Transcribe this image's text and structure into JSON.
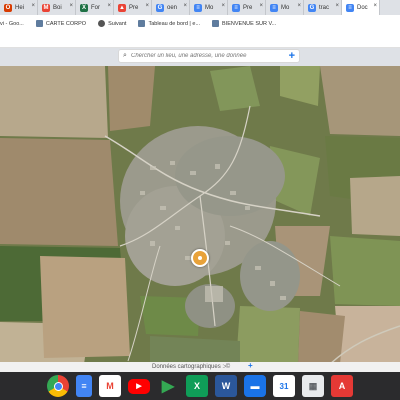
{
  "tabs": [
    {
      "label": "Hei",
      "icon": "office-icon",
      "color": "#d83b01",
      "glyph": "O"
    },
    {
      "label": "Boi",
      "icon": "gmail-icon",
      "color": "#ea4335",
      "glyph": "M"
    },
    {
      "label": "For",
      "icon": "excel-icon",
      "color": "#1e7145",
      "glyph": "X"
    },
    {
      "label": "Pre",
      "icon": "photos-icon",
      "color": "#ea4335",
      "glyph": "▲"
    },
    {
      "label": "oen",
      "icon": "google-icon",
      "color": "#4285f4",
      "glyph": "G"
    },
    {
      "label": "Mo",
      "icon": "doc-icon",
      "color": "#4285f4",
      "glyph": "≡"
    },
    {
      "label": "Pre",
      "icon": "doc-icon",
      "color": "#4285f4",
      "glyph": "≡"
    },
    {
      "label": "Mo",
      "icon": "doc-icon",
      "color": "#4285f4",
      "glyph": "≡"
    },
    {
      "label": "trac",
      "icon": "google-icon",
      "color": "#4285f4",
      "glyph": "G"
    },
    {
      "label": "Doc",
      "icon": "doc-icon",
      "color": "#4285f4",
      "glyph": "≡"
    }
  ],
  "tab_close": "×",
  "bookmarks": [
    {
      "label": "vi - Goo...",
      "icon": "none"
    },
    {
      "label": "CARTE CORPO",
      "icon": "map-icon"
    },
    {
      "label": "Suivant",
      "icon": "globe-icon"
    },
    {
      "label": "Tableau de bord | e...",
      "icon": "map-icon"
    },
    {
      "label": "BIENVENUE SUR V...",
      "icon": "map-icon"
    }
  ],
  "search": {
    "placeholder": "Chercher un lieu, une adresse, une donnée",
    "plus": "+"
  },
  "map_footer": {
    "label": "Données cartographiques : ©",
    "arrow": "›",
    "plus": "+"
  },
  "shelf": [
    {
      "name": "chrome-icon",
      "color": "#4285f4",
      "glyph": "◉"
    },
    {
      "name": "docs-icon",
      "color": "#4285f4",
      "glyph": "≡"
    },
    {
      "name": "gmail-icon",
      "color": "#ea4335",
      "glyph": "M"
    },
    {
      "name": "youtube-icon",
      "color": "#ff0000",
      "glyph": "▶"
    },
    {
      "name": "play-store-icon",
      "color": "#34a853",
      "glyph": "▶"
    },
    {
      "name": "sheets-icon",
      "color": "#0f9d58",
      "glyph": "X"
    },
    {
      "name": "word-icon",
      "color": "#2b579a",
      "glyph": "W"
    },
    {
      "name": "files-icon",
      "color": "#1a73e8",
      "glyph": "▬"
    },
    {
      "name": "calendar-icon",
      "color": "#1a73e8",
      "glyph": "31"
    },
    {
      "name": "calculator-icon",
      "color": "#5f6368",
      "glyph": "▦"
    },
    {
      "name": "pdf-icon",
      "color": "#e53935",
      "glyph": "A"
    }
  ]
}
